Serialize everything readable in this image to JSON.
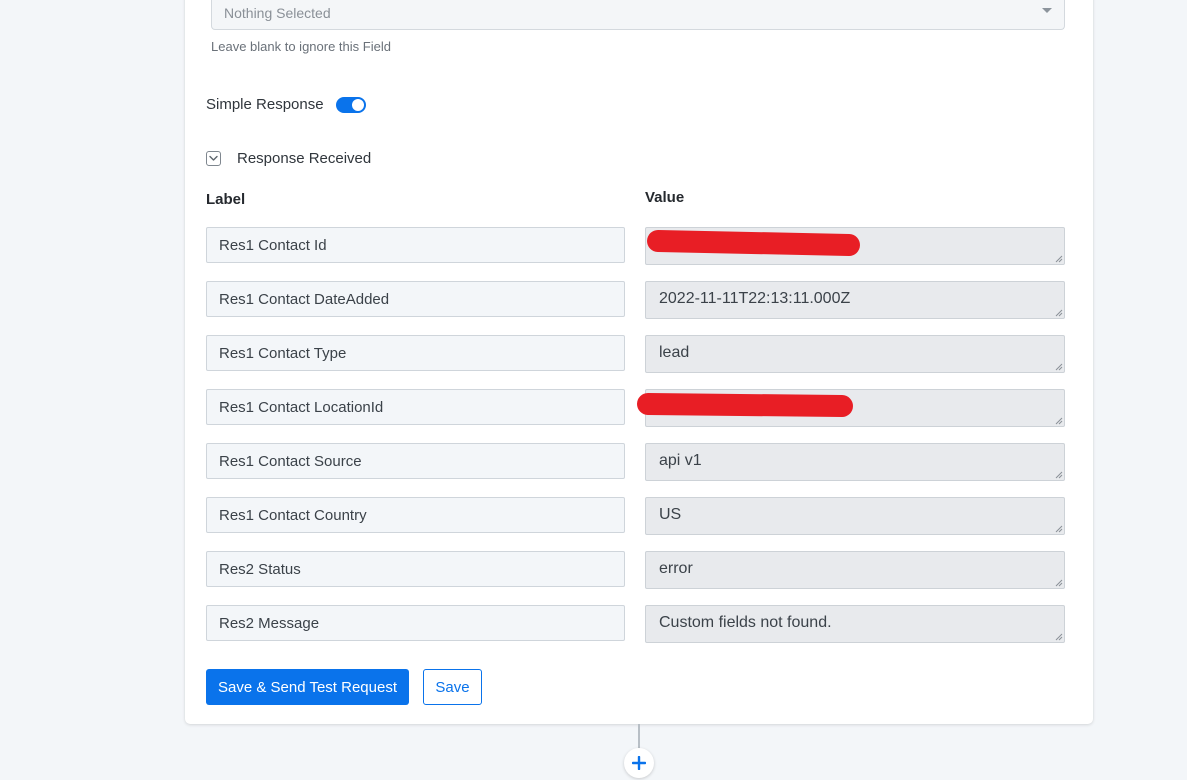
{
  "field": {
    "select_value": "Nothing Selected",
    "hint": "Leave blank to ignore this Field"
  },
  "simple_response": {
    "label": "Simple Response",
    "enabled": true
  },
  "response": {
    "title": "Response Received",
    "expanded": true,
    "label_header": "Label",
    "value_header": "Value",
    "rows": [
      {
        "label": "Res1 Contact Id",
        "value": "",
        "redacted": true
      },
      {
        "label": "Res1 Contact DateAdded",
        "value": "2022-11-11T22:13:11.000Z"
      },
      {
        "label": "Res1 Contact Type",
        "value": "lead"
      },
      {
        "label": "Res1 Contact LocationId",
        "value": "",
        "redacted": true
      },
      {
        "label": "Res1 Contact Source",
        "value": "api v1"
      },
      {
        "label": "Res1 Contact Country",
        "value": "US"
      },
      {
        "label": "Res2 Status",
        "value": "error"
      },
      {
        "label": "Res2 Message",
        "value": "Custom fields not found."
      }
    ]
  },
  "actions": {
    "send_test": "Save & Send Test Request",
    "save": "Save"
  },
  "colors": {
    "accent": "#0a73eb",
    "redaction": "#e81e25"
  },
  "icons": {
    "caret": "caret-down-icon",
    "collapse": "chevron-down-icon",
    "add_step": "plus-icon"
  }
}
